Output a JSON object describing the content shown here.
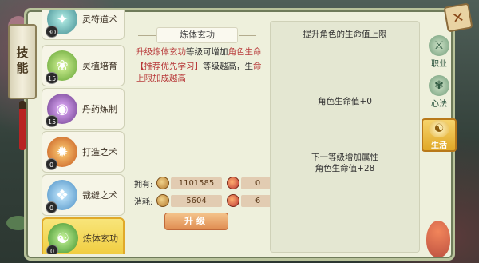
{
  "left_tab": {
    "label": "技能"
  },
  "skills": [
    {
      "name": "灵符道术",
      "level": "30",
      "icon": "talisman-icon",
      "color": "#3f8a8f"
    },
    {
      "name": "灵植培育",
      "level": "15",
      "icon": "plant-icon",
      "color": "#5fa131"
    },
    {
      "name": "丹药炼制",
      "level": "15",
      "icon": "cauldron-icon",
      "color": "#6a3a8a"
    },
    {
      "name": "打造之术",
      "level": "0",
      "icon": "forge-icon",
      "color": "#c4561c"
    },
    {
      "name": "裁缝之术",
      "level": "0",
      "icon": "tailor-icon",
      "color": "#4a8ec4"
    },
    {
      "name": "炼体玄功",
      "level": "0",
      "icon": "body-cultivation-icon",
      "color": "#3c8f2a",
      "active": true
    }
  ],
  "middle": {
    "title": "炼体玄功",
    "desc_red_1": "升级炼体玄功",
    "desc_black_1": "等级可增加",
    "desc_red_2": "角色生命",
    "desc_recommend": "【推荐优先学习】",
    "desc_recommend_rest_black": "等级越高，生",
    "desc_recommend_rest_red": "命上限加成越高",
    "owned_label": "拥有:",
    "owned_value": "1101585",
    "owned_gem": "0",
    "cost_label": "消耗:",
    "cost_value": "5604",
    "cost_gem": "6",
    "upgrade_label": "升级"
  },
  "right": {
    "header": "提升角色的生命值上限",
    "current": "角色生命值+0",
    "next_label": "下一等级增加属性",
    "next_value": "角色生命值+28"
  },
  "side_tabs": [
    {
      "label": "职业",
      "icon": "profession-icon"
    },
    {
      "label": "心法",
      "icon": "mind-method-icon"
    },
    {
      "label": "生活",
      "icon": "life-icon",
      "active": true
    }
  ]
}
